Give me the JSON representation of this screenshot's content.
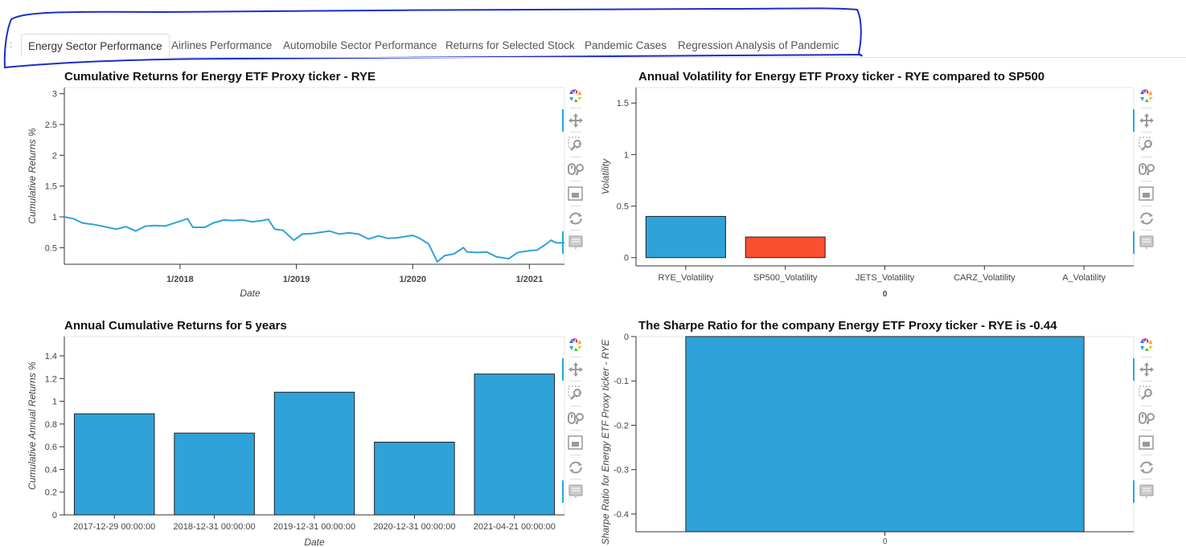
{
  "tabs": {
    "handle": ":",
    "items": [
      {
        "label": "Energy Sector Performance",
        "active": true
      },
      {
        "label": "Airlines Performance",
        "active": false
      },
      {
        "label": "Automobile Sector Performance",
        "active": false
      },
      {
        "label": "Returns for Selected Stock",
        "active": false
      },
      {
        "label": "Pandemic Cases",
        "active": false
      },
      {
        "label": "Regression Analysis of Pandemic",
        "active": false
      }
    ]
  },
  "toolbar": {
    "icons": [
      "bokeh-logo-icon",
      "pan-icon",
      "box-zoom-icon",
      "wheel-zoom-icon",
      "save-icon",
      "reset-icon",
      "hover-icon"
    ]
  },
  "colors": {
    "bar": "#30a2da",
    "bar_alt": "#fc4f30",
    "annotation": "#1a2fc9"
  },
  "chart_data": [
    {
      "type": "line",
      "title": "Cumulative Returns for Energy ETF Proxy ticker - RYE",
      "xlabel": "Date",
      "ylabel": "Cumulative Returns %",
      "x_ticks": [
        "1/2018",
        "1/2019",
        "1/2020",
        "1/2021"
      ],
      "y_ticks": [
        "0.5",
        "1",
        "1.5",
        "2",
        "2.5",
        "3"
      ],
      "ylim": [
        0.23,
        3.1
      ],
      "xlim": [
        "2017-01-03",
        "2021-04-21"
      ],
      "series": [
        {
          "color": "#30a2da",
          "points": [
            [
              "2017-01-03",
              1.0
            ],
            [
              "2017-02-01",
              0.97
            ],
            [
              "2017-03-01",
              0.9
            ],
            [
              "2017-04-01",
              0.88
            ],
            [
              "2017-05-01",
              0.85
            ],
            [
              "2017-06-15",
              0.8
            ],
            [
              "2017-07-15",
              0.84
            ],
            [
              "2017-08-15",
              0.77
            ],
            [
              "2017-09-15",
              0.85
            ],
            [
              "2017-10-15",
              0.86
            ],
            [
              "2017-11-15",
              0.85
            ],
            [
              "2017-12-15",
              0.9
            ],
            [
              "2018-01-25",
              0.97
            ],
            [
              "2018-02-10",
              0.83
            ],
            [
              "2018-03-20",
              0.83
            ],
            [
              "2018-04-15",
              0.9
            ],
            [
              "2018-05-20",
              0.95
            ],
            [
              "2018-06-15",
              0.94
            ],
            [
              "2018-07-15",
              0.95
            ],
            [
              "2018-08-15",
              0.92
            ],
            [
              "2018-09-15",
              0.94
            ],
            [
              "2018-10-05",
              0.96
            ],
            [
              "2018-10-25",
              0.8
            ],
            [
              "2018-11-20",
              0.78
            ],
            [
              "2018-12-24",
              0.62
            ],
            [
              "2019-01-20",
              0.72
            ],
            [
              "2019-02-20",
              0.73
            ],
            [
              "2019-04-15",
              0.77
            ],
            [
              "2019-05-15",
              0.72
            ],
            [
              "2019-06-15",
              0.74
            ],
            [
              "2019-07-15",
              0.72
            ],
            [
              "2019-08-15",
              0.64
            ],
            [
              "2019-09-15",
              0.69
            ],
            [
              "2019-10-15",
              0.65
            ],
            [
              "2019-11-15",
              0.66
            ],
            [
              "2019-12-31",
              0.7
            ],
            [
              "2020-01-20",
              0.66
            ],
            [
              "2020-02-20",
              0.56
            ],
            [
              "2020-03-18",
              0.27
            ],
            [
              "2020-04-10",
              0.37
            ],
            [
              "2020-05-10",
              0.4
            ],
            [
              "2020-06-08",
              0.5
            ],
            [
              "2020-06-20",
              0.43
            ],
            [
              "2020-07-20",
              0.42
            ],
            [
              "2020-08-20",
              0.43
            ],
            [
              "2020-09-20",
              0.35
            ],
            [
              "2020-10-28",
              0.32
            ],
            [
              "2020-11-25",
              0.42
            ],
            [
              "2020-12-31",
              0.45
            ],
            [
              "2021-01-25",
              0.46
            ],
            [
              "2021-02-20",
              0.55
            ],
            [
              "2021-03-10",
              0.62
            ],
            [
              "2021-03-25",
              0.58
            ],
            [
              "2021-04-21",
              0.58
            ]
          ]
        }
      ]
    },
    {
      "type": "bar",
      "title": "Annual Volatility for Energy ETF Proxy ticker - RYE compared to SP500",
      "xlabel": "0",
      "ylabel": "Volatility",
      "categories": [
        "RYE_Volatility",
        "SP500_Volatility",
        "JETS_Volatility",
        "CARZ_Volatility",
        "A_Volatility"
      ],
      "values": [
        0.4,
        0.2,
        0,
        0,
        0
      ],
      "bar_colors": [
        "#30a2da",
        "#fc4f30",
        "#30a2da",
        "#30a2da",
        "#30a2da"
      ],
      "y_ticks": [
        "0",
        "0.5",
        "1",
        "1.5"
      ],
      "ylim": [
        -0.08,
        1.65
      ]
    },
    {
      "type": "bar",
      "title": "Annual Cumulative Returns for 5 years",
      "xlabel": "Date",
      "ylabel": "Cumulative Annual Returns %",
      "categories": [
        "2017-12-29 00:00:00",
        "2018-12-31 00:00:00",
        "2019-12-31 00:00:00",
        "2020-12-31 00:00:00",
        "2021-04-21 00:00:00"
      ],
      "values": [
        0.89,
        0.72,
        1.08,
        0.64,
        1.24
      ],
      "y_ticks": [
        "0",
        "0.2",
        "0.4",
        "0.6",
        "0.8",
        "1",
        "1.2",
        "1.4"
      ],
      "ylim": [
        0,
        1.57
      ]
    },
    {
      "type": "bar",
      "title": "The Sharpe Ratio for the company Energy ETF Proxy ticker - RYE is -0.44",
      "xlabel": "0",
      "ylabel": "Sharpe Ratio for Energy ETF Proxy ticker - RYE",
      "categories": [
        "0"
      ],
      "values": [
        -0.44
      ],
      "y_ticks": [
        "0",
        "-0.1",
        "-0.2",
        "-0.3",
        "-0.4"
      ],
      "ylim": [
        -0.44,
        0
      ]
    }
  ]
}
